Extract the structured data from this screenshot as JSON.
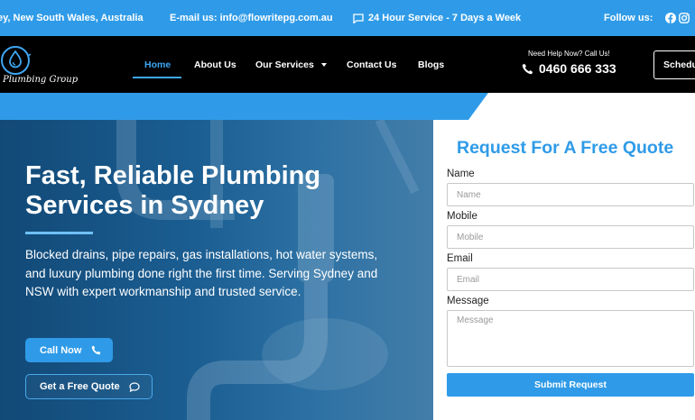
{
  "topbar": {
    "location": "ey, New South Wales, Australia",
    "email": "E-mail us: info@flowritepg.com.au",
    "service_hours": "24 Hour Service - 7 Days a Week",
    "follow_label": "Follow us:"
  },
  "brand": {
    "logo_text": "Plumbing Group",
    "accent_color": "#2f9be8"
  },
  "nav": {
    "home": "Home",
    "about": "About Us",
    "services": "Our Services",
    "contact": "Contact Us",
    "blogs": "Blogs",
    "active": "Home"
  },
  "header": {
    "help_label": "Need Help Now? Call Us!",
    "phone": "0460 666 333",
    "schedule_button": "Schedu"
  },
  "hero": {
    "title": "Fast, Reliable Plumbing Services in Sydney",
    "description": "Blocked drains, pipe repairs, gas installations, hot water systems, and luxury plumbing done right the first time. Serving Sydney and NSW with expert workmanship and trusted service.",
    "call_button": "Call Now",
    "quote_button": "Get a Free Quote"
  },
  "form": {
    "title": "Request For A Free Quote",
    "name_label": "Name",
    "name_placeholder": "Name",
    "mobile_label": "Mobile",
    "mobile_placeholder": "Mobile",
    "email_label": "Email",
    "email_placeholder": "Email",
    "message_label": "Message",
    "message_placeholder": "Message",
    "submit_label": "Submit Request"
  },
  "icons": {
    "service": "chat-bubble-icon",
    "facebook": "facebook-icon",
    "instagram": "instagram-icon",
    "phone": "phone-icon",
    "call": "phone-icon",
    "quote": "chat-bubble-icon",
    "logo": "water-drop-logo-icon",
    "dropdown": "caret-down-icon"
  }
}
